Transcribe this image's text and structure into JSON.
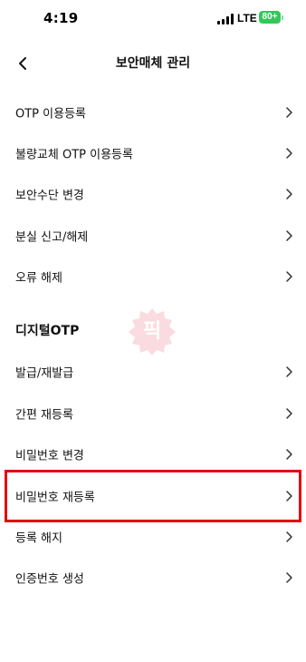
{
  "status_bar": {
    "time": "4:19",
    "network": "LTE",
    "battery": "80+"
  },
  "header": {
    "title": "보안매체 관리"
  },
  "otp_items": [
    {
      "label": "OTP 이용등록"
    },
    {
      "label": "불량교체 OTP 이용등록"
    },
    {
      "label": "보안수단 변경"
    },
    {
      "label": "분실 신고/해제"
    },
    {
      "label": "오류 해제"
    }
  ],
  "digital_section": {
    "title": "디지털OTP",
    "items": [
      {
        "label": "발급/재발급"
      },
      {
        "label": "간편 재등록"
      },
      {
        "label": "비밀번호 변경"
      },
      {
        "label": "비밀번호 재등록",
        "highlighted": true
      },
      {
        "label": "등록 해지"
      },
      {
        "label": "인증번호 생성"
      }
    ]
  },
  "watermark": {
    "text": "픽"
  },
  "colors": {
    "highlight": "#e3070b",
    "battery": "#34c759",
    "watermark": "#e8415a"
  }
}
